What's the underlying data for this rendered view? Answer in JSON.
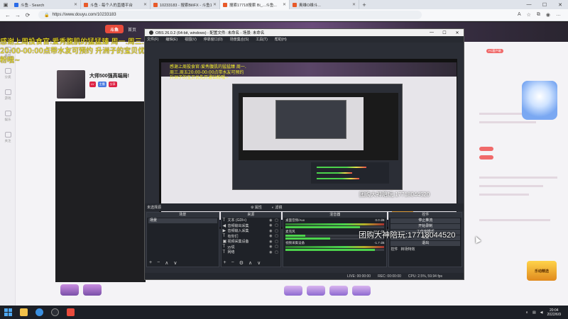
{
  "browser": {
    "tabs": [
      {
        "label": "斗鱼 - Search",
        "favicon": "search-favicon"
      },
      {
        "label": "斗鱼 - 每个人的直播平台",
        "favicon": "douyu-favicon"
      },
      {
        "label": "10233183 - 搜索BiliFX - 斗鱼17...",
        "favicon": "douyu-favicon"
      },
      {
        "label": "搜索17718搜索 Bi_...斗鱼...",
        "favicon": "douyu-favicon"
      },
      {
        "label": "奥维O维斗...",
        "favicon": "douyu-favicon"
      }
    ],
    "url": "https://www.douyu.com/10233183",
    "new_tab_label": "+"
  },
  "page": {
    "logo": "斗鱼",
    "nav_home": "首页",
    "streamer_name": "大师500强高端局!",
    "tags": [
      "LV",
      "主播",
      "分享"
    ],
    "sidebar_items": [
      "推荐",
      "分类",
      "游戏",
      "娱乐",
      "关注"
    ],
    "right_chip_1": "PC客户端",
    "corner_badge": "乐动精选"
  },
  "overlay_text": "感谢上周投食官:爱秀腹肌的猛猛臻 周一.周三.周五20:00-00:00点带水友可预约 升洲子的宝贝优先开通钻粉哦~",
  "obs": {
    "title": "OBS 26.0.2 (64-bit, windows) - 配置文件: 未命名 - 场景: 未命名",
    "menu": [
      "文件(F)",
      "编辑(E)",
      "视图(V)",
      "停靠窗口(D)",
      "场景集合(S)",
      "工具(T)",
      "帮助(H)"
    ],
    "docks_bar_label": "未选择源",
    "docks_bar_buttons": [
      "属性",
      "滤镜"
    ],
    "scenes": {
      "header": "场景",
      "items": [
        "场景"
      ]
    },
    "sources": {
      "header": "来源",
      "items": [
        {
          "icon": "T",
          "name": "文本 (GDI+)"
        },
        {
          "icon": "◀",
          "name": "音频输出采集"
        },
        {
          "icon": "▶",
          "name": "音频输入采集"
        },
        {
          "icon": "T",
          "name": "有你们"
        },
        {
          "icon": "▣",
          "name": "视频采集设备"
        },
        {
          "icon": "T",
          "name": "yy说"
        },
        {
          "icon": "T",
          "name": "网络"
        }
      ]
    },
    "mixer": {
      "header": "混音器",
      "channels": [
        {
          "name": "桌面音频/Aux",
          "db": "0.0 dB"
        },
        {
          "name": "麦克风",
          "db": "-16.7 dB"
        },
        {
          "name": "视频采集设备",
          "db": "-1.7 dB"
        }
      ]
    },
    "controls": {
      "header": "控件",
      "buttons": [
        "停止推流",
        "开始录制",
        "工作室模式",
        "设置",
        "退出"
      ],
      "tabs": [
        "控件",
        "转场特效"
      ]
    },
    "status": {
      "live": "LIVE: 00:00:00",
      "rec": "REC: 00:00:00",
      "cpu": "CPU: 2.5%, 59.94 fps"
    },
    "preview_watermark": "团购大神陪玩:17718044520",
    "preview_overlay": "感谢上周投食官:爱秀腹肌的猛猛臻 周一.周三.周五20:00-00:00点带水友可预约 升洲子的宝贝优先开通钻粉哦~"
  },
  "watermark": "团购大神陪玩:17718044520",
  "taskbar": {
    "time": "20:04",
    "date": "2022/6/9"
  }
}
